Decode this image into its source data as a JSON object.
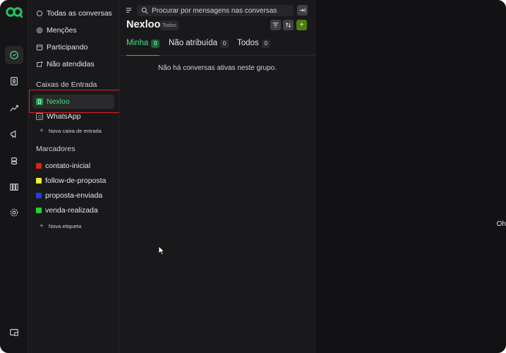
{
  "sidebar": {
    "nav": [
      {
        "label": "Todas as conversas",
        "icon": "chat-bubble-icon"
      },
      {
        "label": "Menções",
        "icon": "at-sign-icon"
      },
      {
        "label": "Participando",
        "icon": "calendar-icon"
      },
      {
        "label": "Não atendidas",
        "icon": "unread-icon"
      }
    ],
    "inboxes_title": "Caixas de Entrada",
    "inboxes": [
      {
        "label": "Nexloo",
        "icon": "inbox-channel-icon",
        "selected": true
      },
      {
        "label": "WhatsApp",
        "icon": "whatsapp-icon",
        "selected": false
      }
    ],
    "new_inbox": "Nova caixa de entrada",
    "labels_title": "Marcadores",
    "labels": [
      {
        "label": "contato-inicial",
        "color": "#e11d1d"
      },
      {
        "label": "follow-de-proposta",
        "color": "#eaf02a"
      },
      {
        "label": "proposta-enviada",
        "color": "#1d3ee8"
      },
      {
        "label": "venda-realizada",
        "color": "#22d32f"
      }
    ],
    "new_label": "Nova etiqueta"
  },
  "panel": {
    "search_placeholder": "Procurar por mensagens nas conversas",
    "title": "Nexloo",
    "title_badge": "Todos",
    "tabs": [
      {
        "label": "Minha",
        "count": "0",
        "active": true
      },
      {
        "label": "Não atribuída",
        "count": "0",
        "active": false
      },
      {
        "label": "Todos",
        "count": "0",
        "active": false
      }
    ],
    "empty_message": "Não há conversas ativas neste grupo."
  },
  "main": {
    "partial_text": "Oh"
  },
  "colors": {
    "accent": "#22c55e",
    "highlight": "#e11d2b"
  }
}
